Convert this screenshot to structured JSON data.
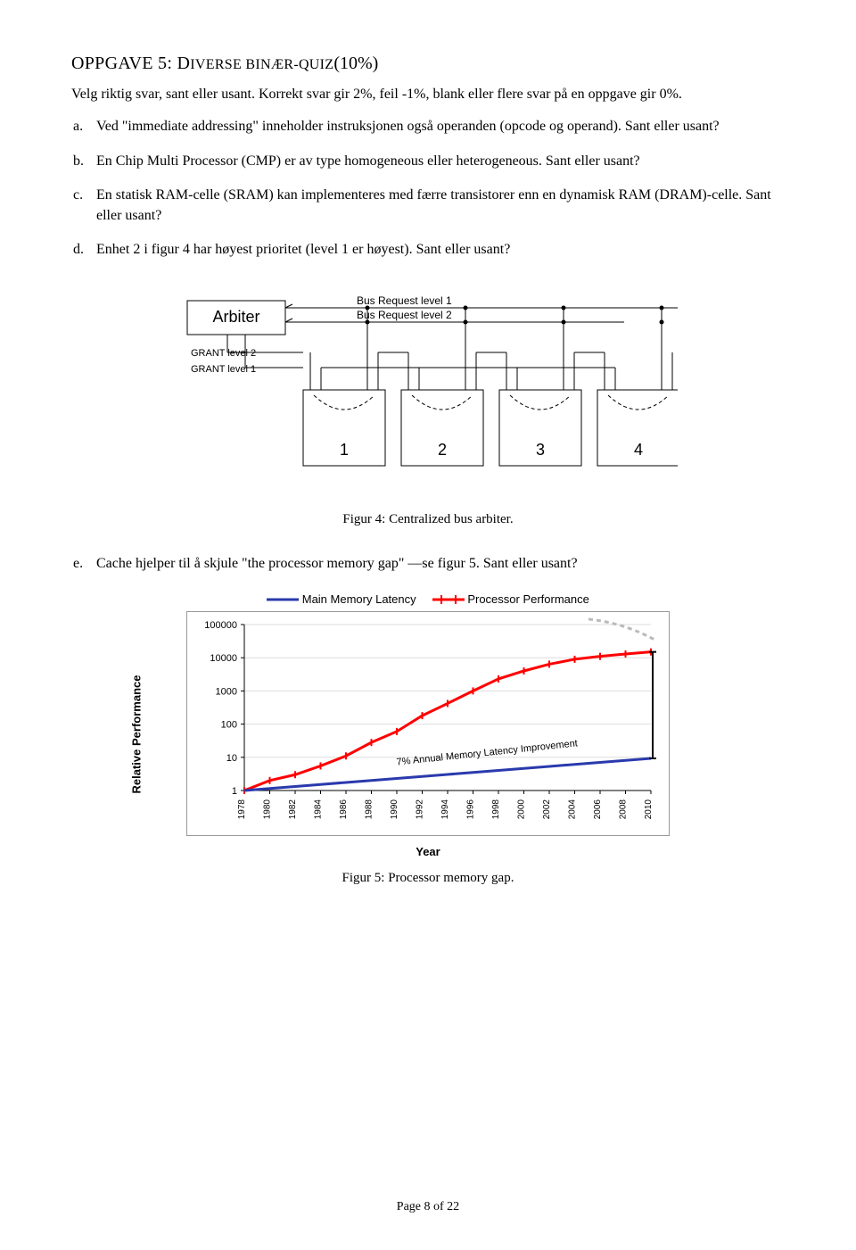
{
  "heading_prefix": "OPPGAVE 5:   D",
  "heading_rest": "IVERSE BINÆR-QUIZ",
  "heading_pct": "(10%)",
  "intro": "Velg riktig svar, sant eller usant. Korrekt svar gir 2%, feil -1%, blank eller flere svar på en oppgave gir 0%.",
  "q": {
    "a": {
      "m": "a.",
      "t": "Ved \"immediate addressing\" inneholder instruksjonen også operanden (opcode og operand). Sant eller usant?"
    },
    "b": {
      "m": "b.",
      "t": "En Chip Multi Processor (CMP) er av type homogeneous eller heterogeneous. Sant eller usant?"
    },
    "c": {
      "m": "c.",
      "t": "En statisk RAM-celle (SRAM) kan implementeres med færre transistorer enn en dynamisk RAM (DRAM)-celle. Sant eller usant?"
    },
    "d": {
      "m": "d.",
      "t": "Enhet 2 i figur 4 har høyest prioritet (level 1 er høyest). Sant eller usant?"
    },
    "e": {
      "m": "e.",
      "t": "Cache hjelper til å skjule \"the processor memory gap\" —se figur 5. Sant eller usant?"
    }
  },
  "fig4": {
    "arbiter": "Arbiter",
    "brl1": "Bus Request level 1",
    "brl2": "Bus Request level 2",
    "gl1": "GRANT level 1",
    "gl2": "GRANT level 2",
    "n1": "1",
    "n2": "2",
    "n3": "3",
    "n4": "4",
    "caption": "Figur 4: Centralized bus arbiter."
  },
  "fig5": {
    "caption": "Figur 5: Processor memory gap.",
    "legend1": "Main Memory Latency",
    "legend2": "Processor Performance",
    "ylabel": "Relative Performance",
    "xlabel": "Year",
    "annot": "7% Annual Memory Latency Improvement"
  },
  "chart_data": {
    "type": "line",
    "title": "",
    "xlabel": "Year",
    "ylabel": "Relative Performance",
    "yscale": "log",
    "ylim": [
      1,
      100000
    ],
    "yticks": [
      1,
      10,
      100,
      1000,
      10000,
      100000
    ],
    "categories": [
      1978,
      1980,
      1982,
      1984,
      1986,
      1988,
      1990,
      1992,
      1994,
      1996,
      1998,
      2000,
      2002,
      2004,
      2006,
      2008,
      2010
    ],
    "series": [
      {
        "name": "Processor Performance",
        "color": "#ff0000",
        "values": [
          1,
          2,
          3,
          5.5,
          11,
          28,
          60,
          180,
          420,
          1000,
          2300,
          4000,
          6400,
          9000,
          11000,
          13000,
          15000
        ]
      },
      {
        "name": "Main Memory Latency",
        "color": "#2a3aad",
        "values": [
          1,
          1.15,
          1.32,
          1.52,
          1.75,
          2.01,
          2.31,
          2.65,
          3.05,
          3.5,
          4.03,
          4.63,
          5.32,
          6.11,
          7.03,
          8.08,
          9.28
        ]
      }
    ],
    "annotation": "7% Annual Memory Latency Improvement"
  },
  "footer": "Page 8 of 22"
}
